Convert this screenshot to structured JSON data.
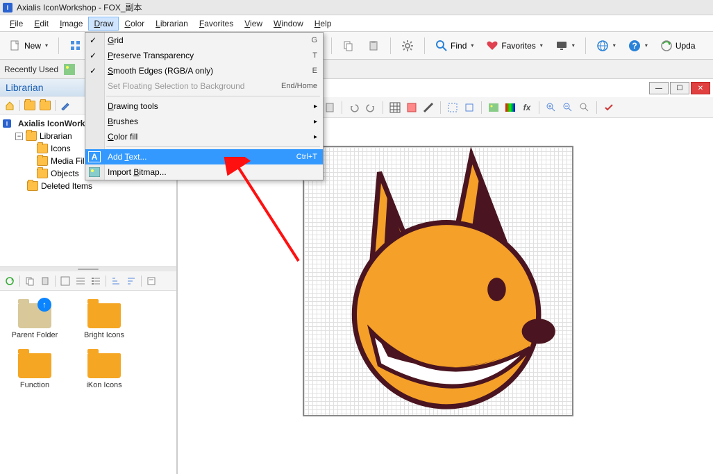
{
  "title": "Axialis IconWorkshop - FOX_副本",
  "menubar": [
    "File",
    "Edit",
    "Image",
    "Draw",
    "Color",
    "Librarian",
    "Favorites",
    "View",
    "Window",
    "Help"
  ],
  "active_menu_index": 3,
  "toolbar": {
    "new_label": "New",
    "find_label": "Find",
    "favorites_label": "Favorites",
    "update_label": "Upda"
  },
  "recently_used": "Recently Used",
  "librarian": {
    "title": "Librarian",
    "root": "Axialis IconWorkshop",
    "nodes": [
      {
        "label": "Librarian",
        "expanded": true,
        "children": [
          {
            "label": "Icons"
          },
          {
            "label": "Media Files"
          },
          {
            "label": "Objects"
          }
        ]
      },
      {
        "label": "Deleted Items"
      }
    ],
    "files": [
      {
        "label": "Parent Folder",
        "type": "parent"
      },
      {
        "label": "Bright Icons",
        "type": "folder"
      },
      {
        "label": "Function",
        "type": "folder"
      },
      {
        "label": "iKon Icons",
        "type": "folder"
      }
    ]
  },
  "draw_menu": [
    {
      "type": "item",
      "label": "Grid",
      "shortcut": "G",
      "checked": true,
      "u": 0
    },
    {
      "type": "item",
      "label": "Preserve Transparency",
      "shortcut": "T",
      "checked": true,
      "u": 0
    },
    {
      "type": "item",
      "label": "Smooth Edges (RGB/A only)",
      "shortcut": "E",
      "checked": true,
      "u": 0
    },
    {
      "type": "item",
      "label": "Set Floating Selection to Background",
      "shortcut": "End/Home",
      "disabled": true
    },
    {
      "type": "sep"
    },
    {
      "type": "item",
      "label": "Drawing tools",
      "submenu": true,
      "u": 0
    },
    {
      "type": "item",
      "label": "Brushes",
      "submenu": true,
      "u": 0
    },
    {
      "type": "item",
      "label": "Color fill",
      "submenu": true,
      "u": 0
    },
    {
      "type": "sep"
    },
    {
      "type": "item",
      "label": "Add Text...",
      "shortcut": "Ctrl+T",
      "highlighted": true,
      "icon": "text",
      "u": 4
    },
    {
      "type": "item",
      "label": "Import Bitmap...",
      "icon": "image",
      "u": 7
    }
  ]
}
